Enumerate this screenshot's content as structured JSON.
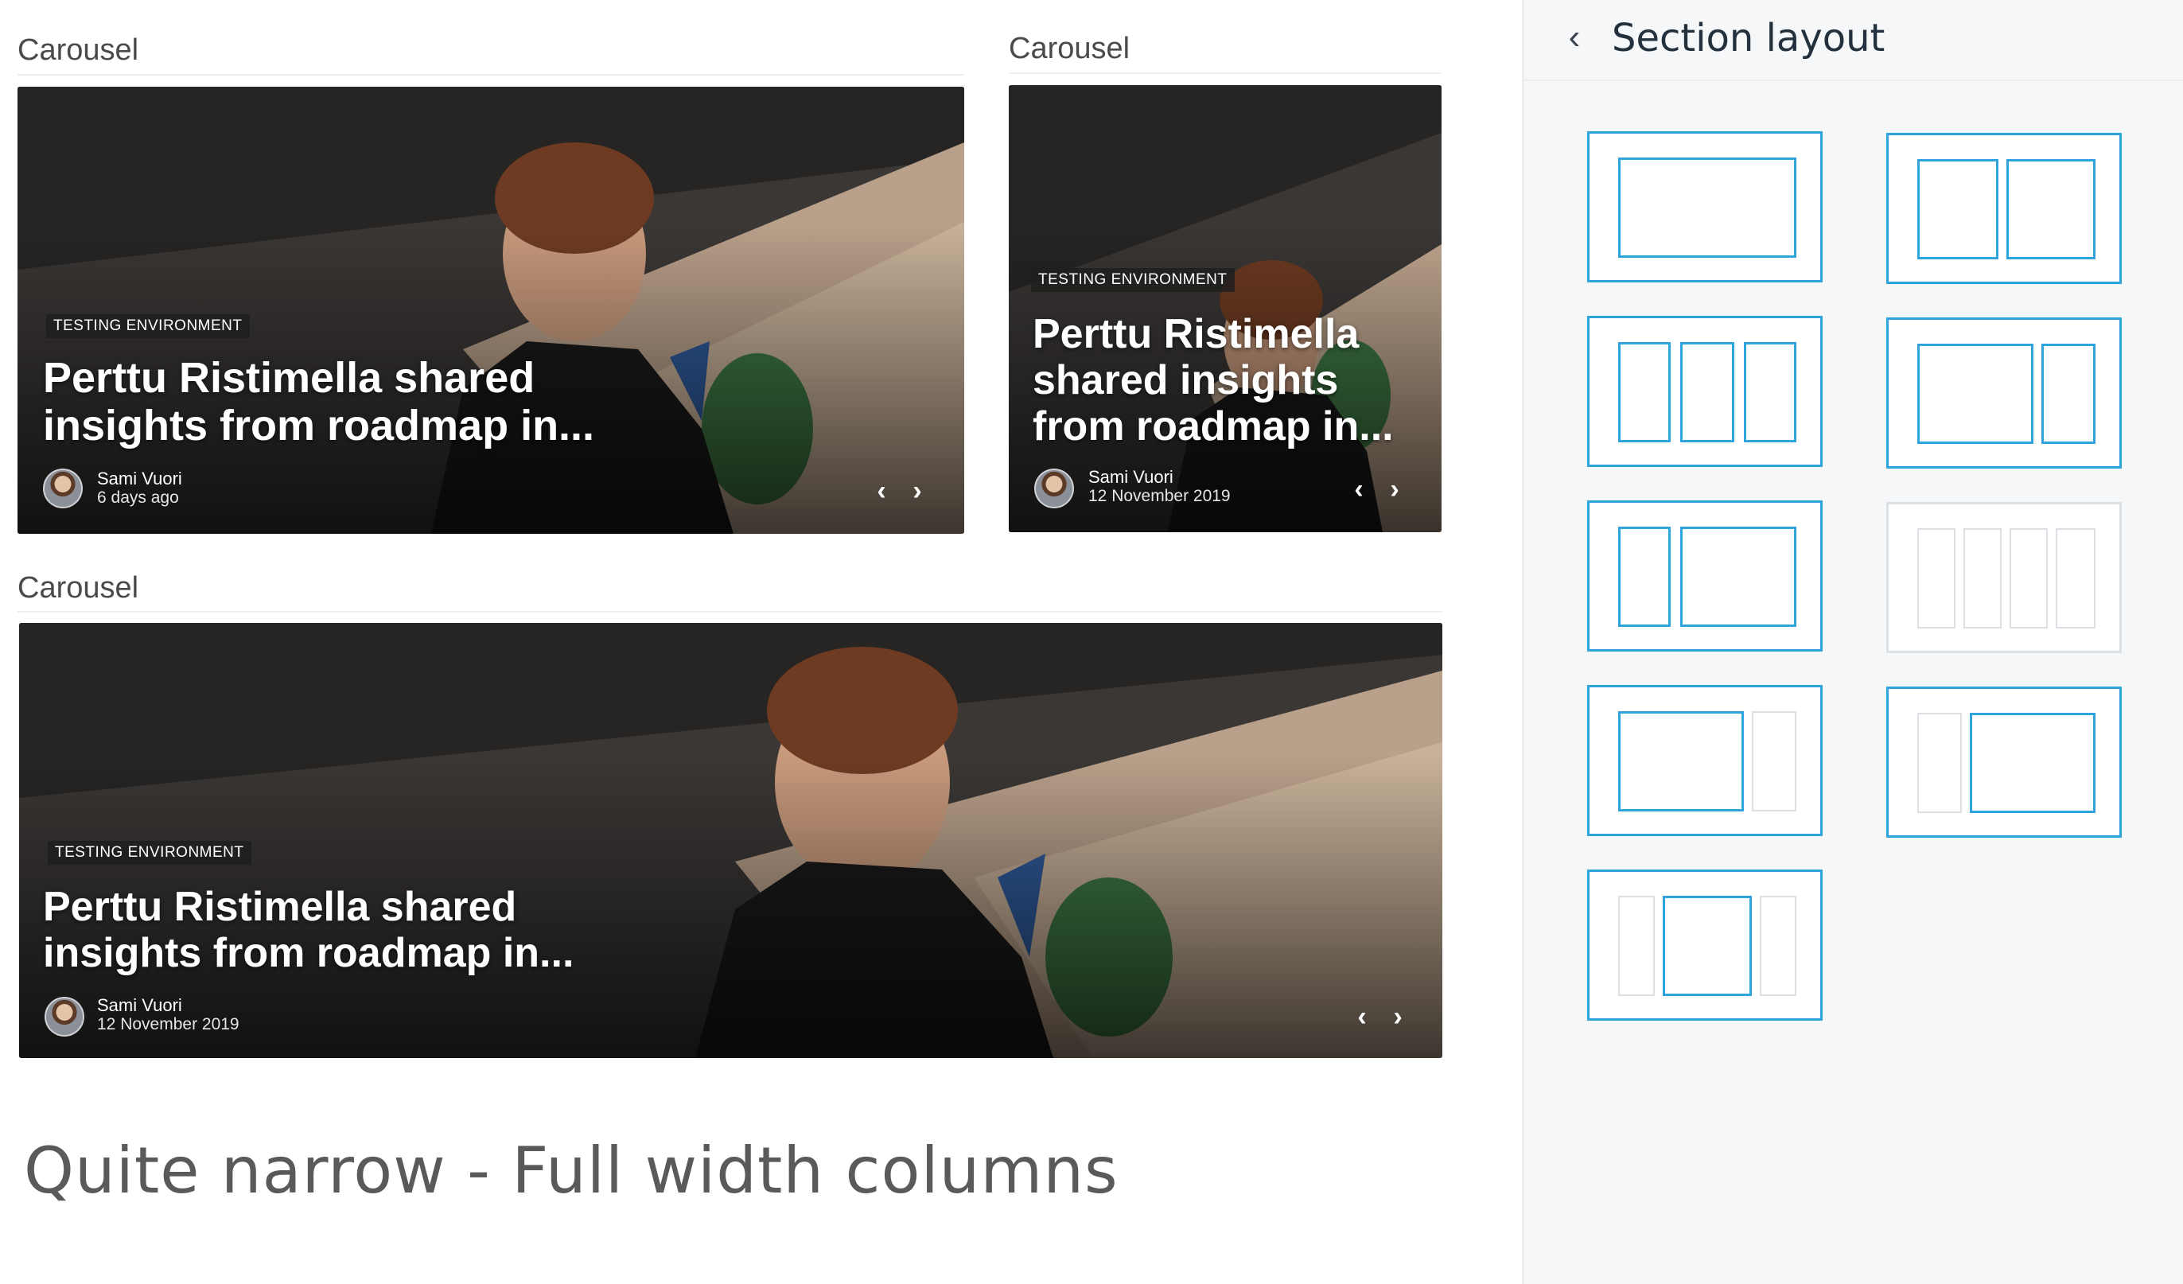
{
  "main": {
    "carousels": [
      {
        "section_label": "Carousel",
        "tag": "TESTING ENVIRONMENT",
        "title": "Perttu Ristimella shared insights from roadmap in...",
        "author": "Sami Vuori",
        "date": "6 days ago"
      },
      {
        "section_label": "Carousel",
        "tag": "TESTING ENVIRONMENT",
        "title": "Perttu Ristimella shared insights from roadmap in...",
        "author": "Sami Vuori",
        "date": "12 November 2019"
      },
      {
        "section_label": "Carousel",
        "tag": "TESTING ENVIRONMENT",
        "title": "Perttu Ristimella shared insights from roadmap in...",
        "author": "Sami Vuori",
        "date": "12 November 2019"
      }
    ],
    "arrows": {
      "prev": "‹",
      "next": "›"
    },
    "heading": "Quite narrow - Full width columns"
  },
  "panel": {
    "back_icon": "‹",
    "title": "Section layout",
    "accent_color": "#2ea3dd",
    "disabled_color": "#dcdfe3",
    "layouts": [
      {
        "name": "one-column",
        "enabled": true
      },
      {
        "name": "two-columns",
        "enabled": true
      },
      {
        "name": "three-columns",
        "enabled": true
      },
      {
        "name": "wide-left-narrow-right",
        "enabled": true
      },
      {
        "name": "narrow-left-wide-right",
        "enabled": true
      },
      {
        "name": "four-columns",
        "enabled": false
      },
      {
        "name": "wide-left-sidebar-right",
        "enabled": true
      },
      {
        "name": "sidebar-left-wide-right",
        "enabled": true
      },
      {
        "name": "center-with-sidebars",
        "enabled": true
      }
    ]
  }
}
